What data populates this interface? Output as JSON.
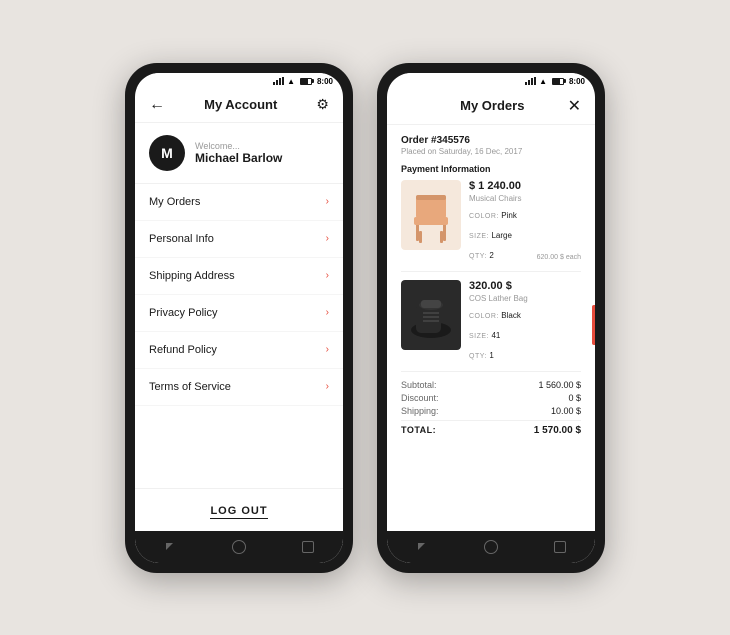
{
  "background": "#e8e4e0",
  "phone1": {
    "statusBar": {
      "time": "8:00"
    },
    "header": {
      "title": "My Account",
      "backLabel": "←",
      "gearLabel": "⚙"
    },
    "user": {
      "initial": "M",
      "welcomeText": "Welcome...",
      "name": "Michael Barlow"
    },
    "menuItems": [
      {
        "label": "My Orders"
      },
      {
        "label": "Personal Info"
      },
      {
        "label": "Shipping Address"
      },
      {
        "label": "Privacy Policy"
      },
      {
        "label": "Refund Policy"
      },
      {
        "label": "Terms of Service"
      }
    ],
    "logoutLabel": "LOG OUT"
  },
  "phone2": {
    "statusBar": {
      "time": "8:00"
    },
    "header": {
      "title": "My Orders",
      "closeLabel": "✕"
    },
    "order": {
      "number": "Order #345576",
      "date": "Placed on Saturday, 16 Dec, 2017"
    },
    "paymentInfoTitle": "Payment Information",
    "items": [
      {
        "price": "$ 1 240.00",
        "name": "Musical Chairs",
        "colorLabel": "COLOR:",
        "colorValue": "Pink",
        "sizeLabel": "SIZE:",
        "sizeValue": "Large",
        "qtyLabel": "QTY:",
        "qtyValue": "2",
        "perUnit": "620.00 $ each",
        "imageType": "chair"
      },
      {
        "price": "320.00 $",
        "name": "COS Lather Bag",
        "colorLabel": "COLOR:",
        "colorValue": "Black",
        "sizeLabel": "SIZE:",
        "sizeValue": "41",
        "qtyLabel": "QTY:",
        "qtyValue": "1",
        "imageType": "bag"
      }
    ],
    "summary": {
      "subtotalLabel": "Subtotal:",
      "subtotalValue": "1 560.00 $",
      "discountLabel": "Discount:",
      "discountValue": "0 $",
      "shippingLabel": "Shipping:",
      "shippingValue": "10.00 $",
      "totalLabel": "TOTAL:",
      "totalValue": "1 570.00 $"
    }
  }
}
